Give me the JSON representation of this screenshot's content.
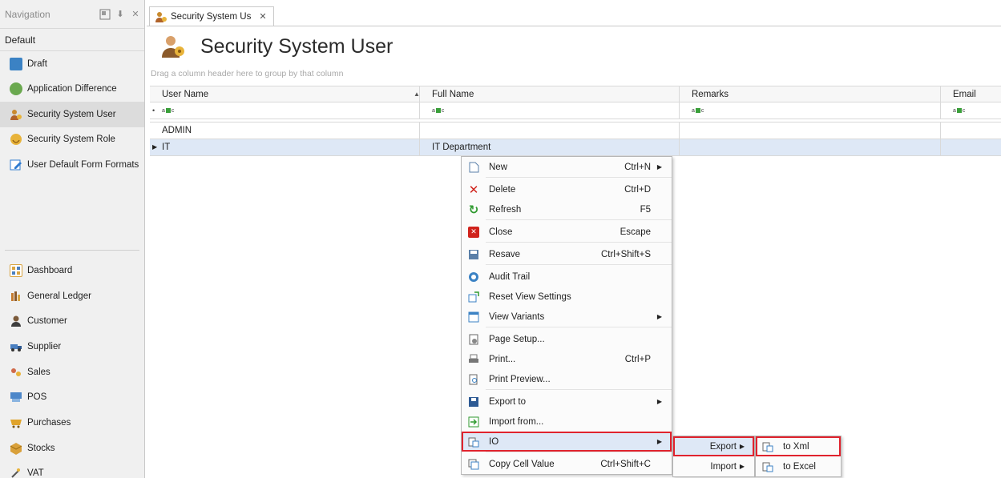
{
  "navigation": {
    "title": "Navigation",
    "group_label": "Default",
    "items": [
      {
        "label": "Draft",
        "icon": "draft-icon",
        "color": "#3b82c4"
      },
      {
        "label": "Application Difference",
        "icon": "app-difference-icon",
        "color": "#6aa84f"
      },
      {
        "label": "Security System User",
        "icon": "user-icon",
        "color": "#c98a2e",
        "selected": true
      },
      {
        "label": "Security System Role",
        "icon": "role-icon",
        "color": "#e8b33a"
      },
      {
        "label": "User Default Form Formats",
        "icon": "form-format-icon",
        "color": "#2f7bd0"
      }
    ],
    "modules": [
      {
        "label": "Dashboard",
        "icon": "dashboard-icon",
        "color": "#d9a441"
      },
      {
        "label": "General Ledger",
        "icon": "ledger-icon",
        "color": "#c47a2e"
      },
      {
        "label": "Customer",
        "icon": "customer-icon",
        "color": "#7b5a3a"
      },
      {
        "label": "Supplier",
        "icon": "supplier-icon",
        "color": "#4a7fc0"
      },
      {
        "label": "Sales",
        "icon": "sales-icon",
        "color": "#d06a4a"
      },
      {
        "label": "POS",
        "icon": "pos-icon",
        "color": "#4d87c9"
      },
      {
        "label": "Purchases",
        "icon": "purchases-icon",
        "color": "#e0a32a"
      },
      {
        "label": "Stocks",
        "icon": "stocks-icon",
        "color": "#d9a03a"
      },
      {
        "label": "VAT",
        "icon": "vat-icon",
        "color": "#555555"
      }
    ]
  },
  "tab": {
    "label": "Security System Us",
    "close": "✕"
  },
  "page": {
    "title": "Security System User",
    "group_hint": "Drag a column header here to group by that column"
  },
  "grid": {
    "columns": [
      "User Name",
      "Full Name",
      "Remarks",
      "Email"
    ],
    "rows": [
      {
        "user_name": "ADMIN",
        "full_name": "",
        "remarks": "",
        "email": ""
      },
      {
        "user_name": "IT",
        "full_name": "IT Department",
        "remarks": "",
        "email": ""
      }
    ]
  },
  "context_menu": {
    "items": [
      {
        "label": "New",
        "shortcut": "Ctrl+N",
        "icon": "new-icon",
        "submenu": true
      },
      {
        "label": "Delete",
        "shortcut": "Ctrl+D",
        "icon": "delete-icon"
      },
      {
        "label": "Refresh",
        "shortcut": "F5",
        "icon": "refresh-icon"
      },
      {
        "label": "Close",
        "shortcut": "Escape",
        "icon": "close-icon"
      },
      {
        "label": "Resave",
        "shortcut": "Ctrl+Shift+S",
        "icon": "resave-icon"
      },
      {
        "label": "Audit Trail",
        "shortcut": "",
        "icon": "audit-trail-icon"
      },
      {
        "label": "Reset View Settings",
        "shortcut": "",
        "icon": "reset-view-icon"
      },
      {
        "label": "View Variants",
        "shortcut": "",
        "icon": "view-variants-icon",
        "submenu": true
      },
      {
        "label": "Page Setup...",
        "shortcut": "",
        "icon": "page-setup-icon"
      },
      {
        "label": "Print...",
        "shortcut": "Ctrl+P",
        "icon": "print-icon"
      },
      {
        "label": "Print Preview...",
        "shortcut": "",
        "icon": "print-preview-icon"
      },
      {
        "label": "Export to",
        "shortcut": "",
        "icon": "export-to-icon",
        "submenu": true
      },
      {
        "label": "Import from...",
        "shortcut": "",
        "icon": "import-from-icon"
      },
      {
        "label": "IO",
        "shortcut": "",
        "icon": "io-icon",
        "submenu": true,
        "highlighted": true
      },
      {
        "label": "Copy Cell Value",
        "shortcut": "Ctrl+Shift+C",
        "icon": "copy-cell-icon"
      }
    ]
  },
  "io_submenu": [
    {
      "label": "Export",
      "highlighted": true
    },
    {
      "label": "Import"
    }
  ],
  "export_submenu": [
    {
      "label": "to Xml",
      "highlighted": true
    },
    {
      "label": "to Excel"
    }
  ],
  "colors": {
    "highlight_border": "#e0232e",
    "selection": "#dee8f6",
    "accent": "#3aa03a"
  }
}
